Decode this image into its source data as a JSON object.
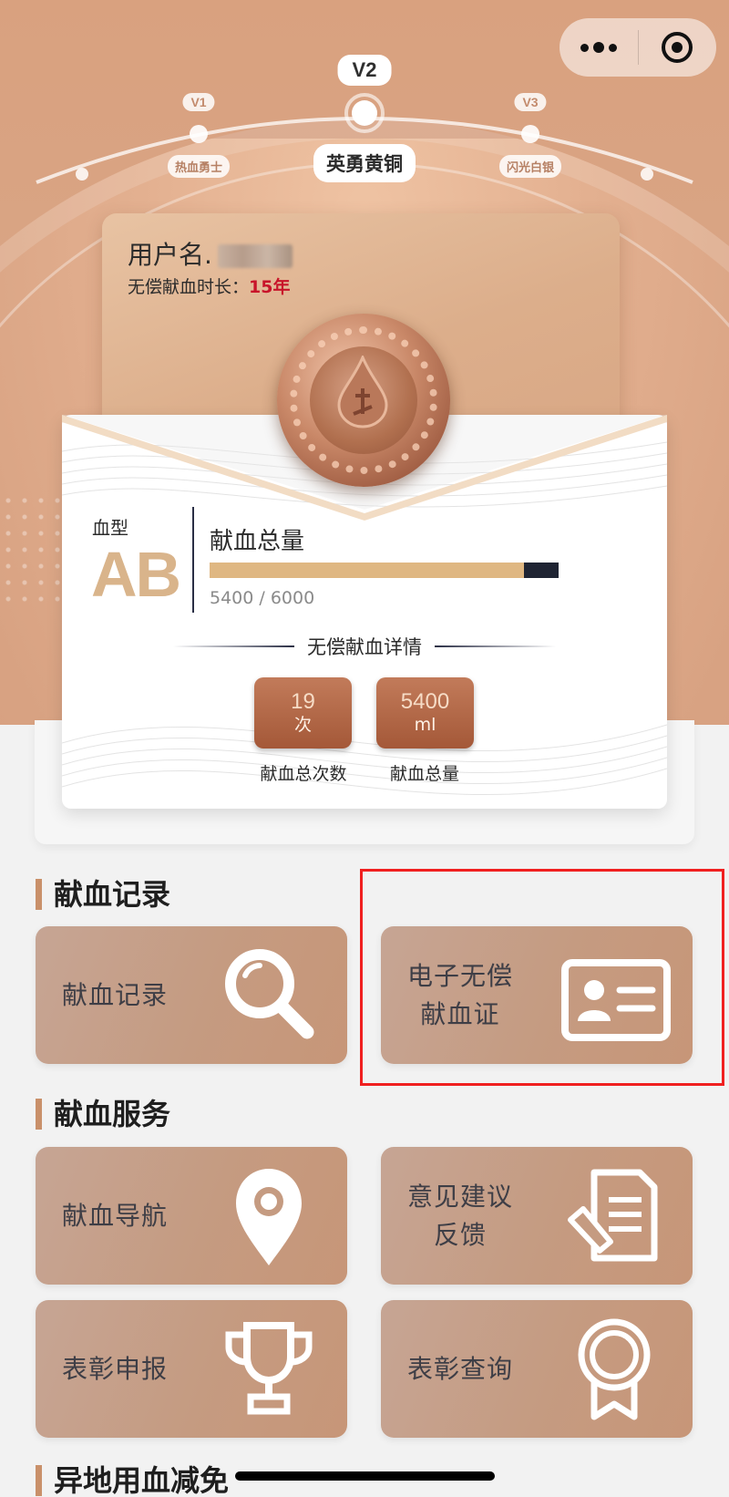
{
  "levels": {
    "items": [
      {
        "code": "V1",
        "name": "热血勇士"
      },
      {
        "code": "V2",
        "name": "英勇黄铜"
      },
      {
        "code": "V3",
        "name": "闪光白银"
      }
    ],
    "current": "V2"
  },
  "capsule": {
    "more_icon": "more-dots-icon",
    "close_icon": "target-circle-icon"
  },
  "user": {
    "name_label": "用户名.",
    "duration_label": "无偿献血时长：",
    "duration_value": "15年"
  },
  "blood": {
    "type_label": "血型",
    "type_value": "AB",
    "total_label": "献血总量",
    "progress_text": "5400 / 6000",
    "progress_current": 5400,
    "progress_max": 6000
  },
  "details": {
    "title": "无偿献血详情",
    "stats": [
      {
        "value": "19",
        "unit": "次",
        "caption": "献血总次数"
      },
      {
        "value": "5400",
        "unit": "ml",
        "caption": "献血总量"
      }
    ]
  },
  "sections": [
    {
      "title": "献血记录",
      "tiles": [
        {
          "label": "献血记录",
          "icon": "magnifier-icon"
        },
        {
          "label_line1": "电子无偿",
          "label_line2": "献血证",
          "icon": "id-card-icon"
        }
      ]
    },
    {
      "title": "献血服务",
      "tiles": [
        {
          "label": "献血导航",
          "icon": "map-pin-icon"
        },
        {
          "label_line1": "意见建议",
          "label_line2": "反馈",
          "icon": "document-pen-icon"
        },
        {
          "label": "表彰申报",
          "icon": "trophy-icon"
        },
        {
          "label": "表彰查询",
          "icon": "award-ribbon-icon"
        }
      ]
    },
    {
      "title": "异地用血减免"
    }
  ],
  "colors": {
    "accent": "#c9906a",
    "tile_bg": "#c59b81",
    "highlight_border": "#f02020",
    "duration_value": "#c8142a",
    "progress_fill": "#dfb782",
    "progress_track": "#1f2433"
  }
}
